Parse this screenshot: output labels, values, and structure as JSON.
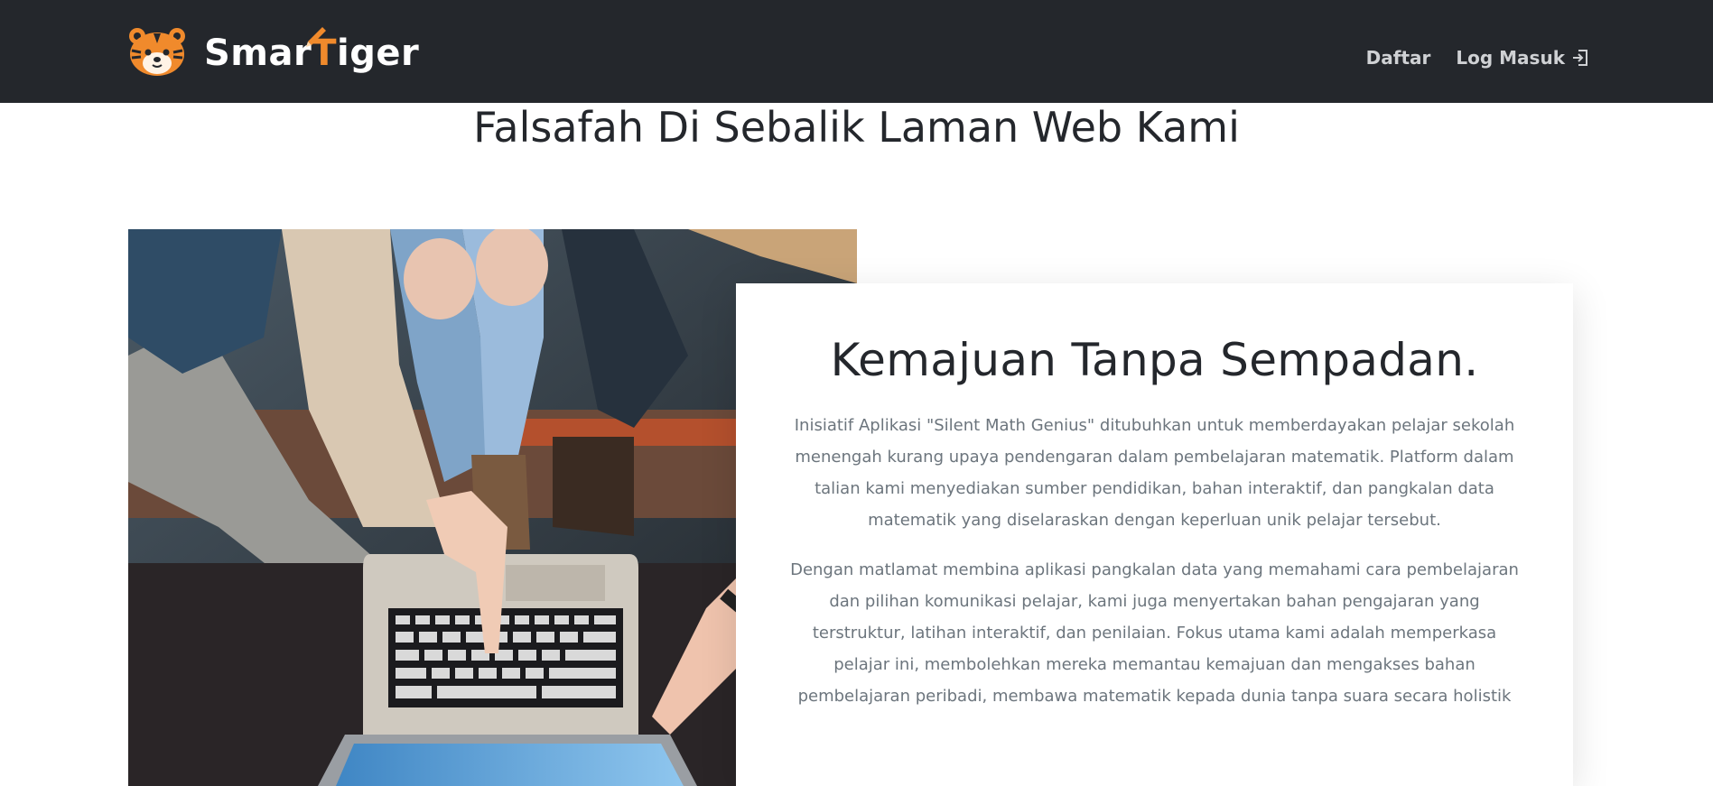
{
  "header": {
    "brand_text_part1": "Smar",
    "brand_text_accent": "T",
    "brand_text_part2": "iger",
    "nav": {
      "register_label": "Daftar",
      "login_label": "Log Masuk"
    }
  },
  "main": {
    "page_title": "Falsafah Di Sebalik Laman Web Kami",
    "card": {
      "title": "Kemajuan Tanpa Sempadan.",
      "paragraph1": "Inisiatif Aplikasi \"Silent Math Genius\" ditubuhkan untuk memberdayakan pelajar sekolah menengah kurang upaya pendengaran dalam pembelajaran matematik. Platform dalam talian kami menyediakan sumber pendidikan, bahan interaktif, dan pangkalan data matematik yang diselaraskan dengan keperluan unik pelajar tersebut.",
      "paragraph2": "Dengan matlamat membina aplikasi pangkalan data yang memahami cara pembelajaran dan pilihan komunikasi pelajar, kami juga menyertakan bahan pengajaran yang terstruktur, latihan interaktif, dan penilaian. Fokus utama kami adalah memperkasa pelajar ini, membolehkan mereka memantau kemajuan dan mengakses bahan pembelajaran peribadi, membawa matematik kepada dunia tanpa suara secara holistik"
    }
  },
  "icons": {
    "logo": "tiger-head-icon",
    "brand_decoration": "pencil-icon",
    "login": "sign-in-icon"
  },
  "colors": {
    "navbar_bg": "#24272c",
    "brand_accent": "#f08a2c",
    "nav_text": "#cfd1d4",
    "body_text": "#6c757d",
    "heading_text": "#24272c"
  }
}
